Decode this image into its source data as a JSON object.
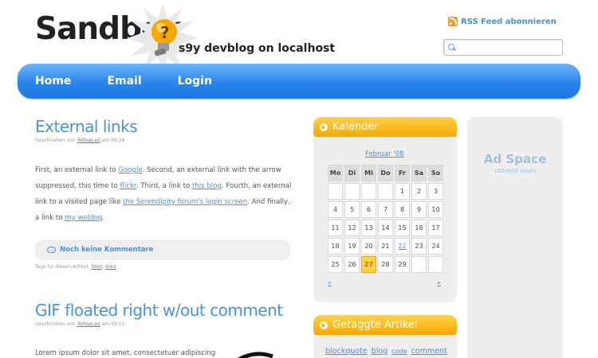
{
  "header": {
    "logo": "Sandbox",
    "tagline": "s9y devblog on localhost",
    "rss_label": "RSS Feed abonnieren",
    "search_placeholder": ""
  },
  "nav": {
    "items": [
      {
        "label": "Home"
      },
      {
        "label": "Email"
      },
      {
        "label": "Login"
      }
    ]
  },
  "posts": [
    {
      "title": "External links",
      "meta_prefix": "Geschrieben von",
      "author": "YellowLed",
      "meta_suffix": "am 09:28",
      "body": {
        "t1": "First, an external link to ",
        "l1": "Google",
        "t2": ". Second, an external link with the arrow suppressed, this time to ",
        "l2": "flickr",
        "t3": ". Third, a link to ",
        "l3": "this blog",
        "t4": ". Fourth, an external link to a visited page like ",
        "l4": "the Serendipity forum's login screen",
        "t5": ". And finally, a link to ",
        "l5": "my weblog",
        "t6": "."
      },
      "comments_label": "Noch keine Kommentare",
      "tags_prefix": "Tags für diesen Artikel:",
      "tags": [
        "html",
        "links"
      ]
    },
    {
      "title": "GIF floated right w/out comment",
      "meta_prefix": "Geschrieben von",
      "author": "YellowLed",
      "meta_suffix": "am 09:01",
      "body_text": "Lorem ipsum dolor sit amet, consectetuer adipiscing"
    }
  ],
  "calendar": {
    "title": "Kalender",
    "month_label": "Februar '08",
    "prev": "«",
    "next": "»",
    "weekdays": [
      "Mo",
      "Di",
      "Mi",
      "Do",
      "Fr",
      "Sa",
      "So"
    ],
    "weeks": [
      [
        "",
        "",
        "",
        "",
        "1",
        "2",
        "3"
      ],
      [
        "4",
        "5",
        "6",
        "7",
        "8",
        "9",
        "10"
      ],
      [
        "11",
        "12",
        "13",
        "14",
        "15",
        "16",
        "17"
      ],
      [
        "18",
        "19",
        "20",
        "21",
        "22",
        "23",
        "24"
      ],
      [
        "25",
        "26",
        "27",
        "28",
        "29",
        "",
        ""
      ]
    ],
    "today": "27",
    "linked_days": [
      "22",
      "27"
    ]
  },
  "tagged": {
    "title": "Getaggte Artikel",
    "tags": [
      "blockquote",
      "blog",
      "code",
      "comment"
    ]
  },
  "ad": {
    "title": "Ad Space",
    "subtitle": "160x600 pixels"
  },
  "colors": {
    "accent_blue": "#4a8fd8",
    "nav_blue": "#2a84eb",
    "sidebar_orange": "#f5a800",
    "today_yellow": "#ffd24a"
  }
}
